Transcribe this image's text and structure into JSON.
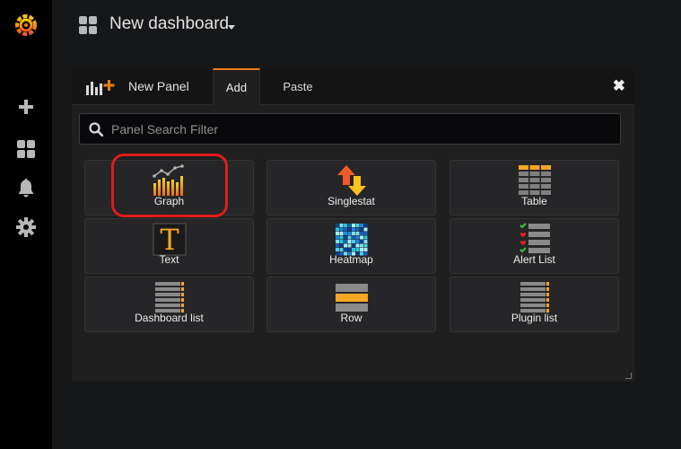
{
  "sidebar": {
    "icons": [
      "grafana-logo-icon",
      "plus-icon",
      "dashboards-icon",
      "bell-icon",
      "gear-icon"
    ]
  },
  "topbar": {
    "title": "New dashboard"
  },
  "panel": {
    "title": "New Panel",
    "tabs": [
      {
        "label": "Add",
        "active": true
      },
      {
        "label": "Paste",
        "active": false
      }
    ],
    "close": "✖",
    "search": {
      "placeholder": "Panel Search Filter",
      "value": ""
    },
    "items": [
      {
        "label": "Graph",
        "icon": "graph-icon",
        "highlighted": true
      },
      {
        "label": "Singlestat",
        "icon": "singlestat-icon"
      },
      {
        "label": "Table",
        "icon": "table-icon"
      },
      {
        "label": "Text",
        "icon": "text-icon"
      },
      {
        "label": "Heatmap",
        "icon": "heatmap-icon"
      },
      {
        "label": "Alert List",
        "icon": "alert-list-icon"
      },
      {
        "label": "Dashboard list",
        "icon": "dashboard-list-icon"
      },
      {
        "label": "Row",
        "icon": "row-icon"
      },
      {
        "label": "Plugin list",
        "icon": "plugin-list-icon"
      }
    ]
  },
  "colors": {
    "accent": "#eb7b18",
    "highlight": "#e01b1b",
    "sidebar": "#000000",
    "background": "#161719"
  }
}
